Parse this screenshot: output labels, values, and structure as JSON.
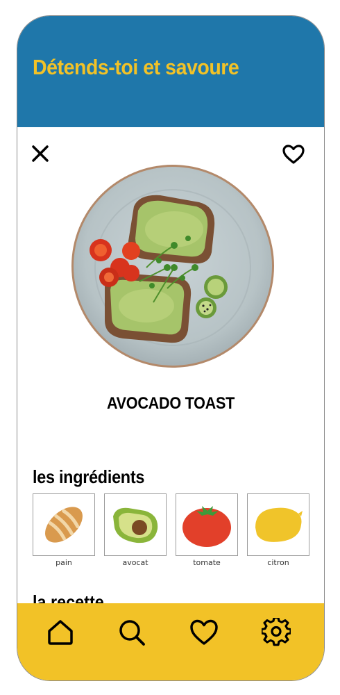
{
  "header": {
    "title": "Détends-toi et savoure"
  },
  "recipe": {
    "title": "AVOCADO TOAST"
  },
  "ingredients_section": {
    "title": "les ingrédients"
  },
  "ingredients": [
    {
      "label": "pain",
      "icon": "bread-icon"
    },
    {
      "label": "avocat",
      "icon": "avocado-icon"
    },
    {
      "label": "tomate",
      "icon": "tomato-icon"
    },
    {
      "label": "citron",
      "icon": "lemon-icon"
    }
  ],
  "recipe_section": {
    "title": "la recette"
  },
  "tabbar": [
    {
      "icon": "home-icon"
    },
    {
      "icon": "search-icon"
    },
    {
      "icon": "heart-icon"
    },
    {
      "icon": "settings-icon"
    }
  ],
  "colors": {
    "header": "#1f77aa",
    "accent": "#f2c227",
    "text": "#000000"
  }
}
